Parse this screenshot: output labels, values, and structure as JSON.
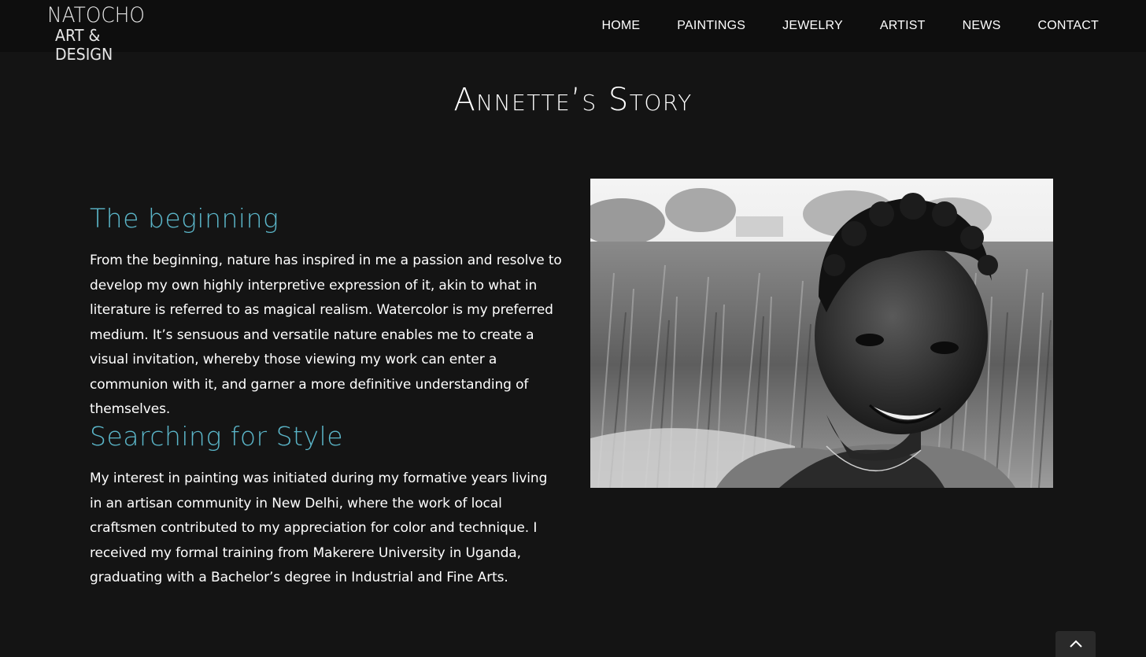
{
  "brand": {
    "logo_line1": "NATOCHO",
    "logo_line2": "ART & DESIGN"
  },
  "nav": {
    "items": [
      {
        "label": "HOME"
      },
      {
        "label": "PAINTINGS"
      },
      {
        "label": "JEWELRY"
      },
      {
        "label": "ARTIST"
      },
      {
        "label": "NEWS"
      },
      {
        "label": "CONTACT"
      }
    ]
  },
  "page": {
    "title": "Annette’s Story"
  },
  "sections": [
    {
      "heading": "The beginning",
      "body": "From the beginning, nature has inspired in me a passion and resolve to develop my own highly interpretive expression of it, akin to what in literature is referred to as magical realism. Watercolor is my preferred medium. It’s sensuous and versatile nature enables me to create a visual invitation, whereby those viewing my work can enter a communion with it, and garner a more definitive understanding of themselves."
    },
    {
      "heading": "Searching for Style",
      "body": "My interest in painting was  initiated  during my formative years living in an artisan community in New Delhi, where the work of local craftsmen contributed to my appreciation for color and technique. I received my formal training from Makerere University in Uganda, graduating with a Bachelor’s degree in Industrial and Fine Arts."
    }
  ],
  "colors": {
    "background": "#141414",
    "header_bg": "#0e0e0e",
    "accent_heading": "#5bb6c9",
    "text": "#ffffff"
  },
  "icons": {
    "back_to_top": "chevron-up-icon"
  }
}
